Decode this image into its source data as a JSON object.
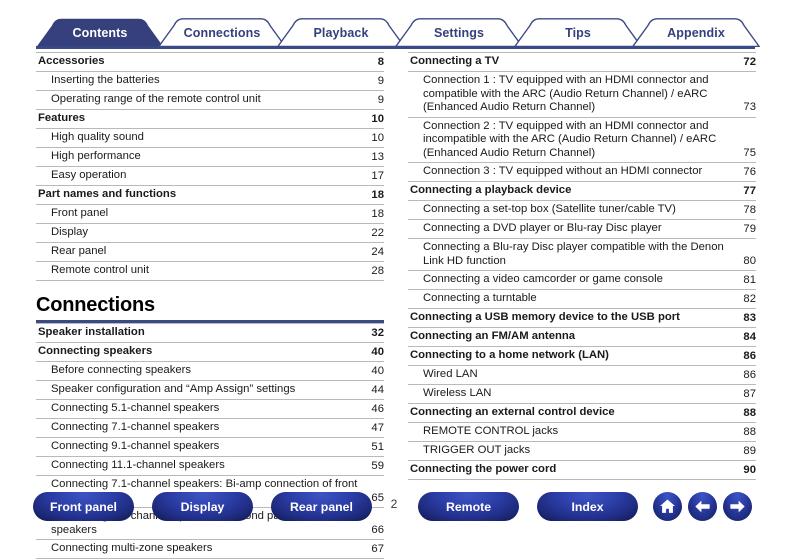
{
  "tabs": [
    {
      "label": "Contents",
      "active": true
    },
    {
      "label": "Connections",
      "active": false
    },
    {
      "label": "Playback",
      "active": false
    },
    {
      "label": "Settings",
      "active": false
    },
    {
      "label": "Tips",
      "active": false
    },
    {
      "label": "Appendix",
      "active": false
    }
  ],
  "left_column": {
    "groups": [
      {
        "type": "list",
        "rows": [
          {
            "level": 1,
            "title": "Accessories",
            "page": "8"
          },
          {
            "level": 2,
            "title": "Inserting the batteries",
            "page": "9"
          },
          {
            "level": 2,
            "title": "Operating range of the remote control unit",
            "page": "9"
          },
          {
            "level": 1,
            "title": "Features",
            "page": "10"
          },
          {
            "level": 2,
            "title": "High quality sound",
            "page": "10"
          },
          {
            "level": 2,
            "title": "High performance",
            "page": "13"
          },
          {
            "level": 2,
            "title": "Easy operation",
            "page": "17"
          },
          {
            "level": 1,
            "title": "Part names and functions",
            "page": "18"
          },
          {
            "level": 2,
            "title": "Front panel",
            "page": "18"
          },
          {
            "level": 2,
            "title": "Display",
            "page": "22"
          },
          {
            "level": 2,
            "title": "Rear panel",
            "page": "24"
          },
          {
            "level": 2,
            "title": "Remote control unit",
            "page": "28"
          }
        ]
      },
      {
        "type": "heading",
        "heading": "Connections"
      },
      {
        "type": "list",
        "rows": [
          {
            "level": 1,
            "title": "Speaker installation",
            "page": "32"
          },
          {
            "level": 1,
            "title": "Connecting speakers",
            "page": "40"
          },
          {
            "level": 2,
            "title": "Before connecting speakers",
            "page": "40"
          },
          {
            "level": 2,
            "title": "Speaker configuration and “Amp Assign” settings",
            "page": "44"
          },
          {
            "level": 2,
            "title": "Connecting 5.1-channel speakers",
            "page": "46"
          },
          {
            "level": 2,
            "title": "Connecting 7.1-channel speakers",
            "page": "47"
          },
          {
            "level": 2,
            "title": "Connecting 9.1-channel speakers",
            "page": "51"
          },
          {
            "level": 2,
            "title": "Connecting 11.1-channel speakers",
            "page": "59"
          },
          {
            "level": 2,
            "title": "Connecting 7.1-channel speakers: Bi-amp connection of front speakers",
            "page": "65"
          },
          {
            "level": 2,
            "title": "Connecting 7.1-channel speakers: Second pair of front speakers",
            "page": "66"
          },
          {
            "level": 2,
            "title": "Connecting multi-zone speakers",
            "page": "67"
          }
        ]
      }
    ]
  },
  "right_column": {
    "groups": [
      {
        "type": "list",
        "rows": [
          {
            "level": 1,
            "title": "Connecting a TV",
            "page": "72"
          },
          {
            "level": 2,
            "title": "Connection 1 : TV equipped with an HDMI connector and compatible with the ARC (Audio Return Channel) / eARC (Enhanced Audio Return Channel)",
            "page": "73"
          },
          {
            "level": 2,
            "title": "Connection 2 : TV equipped with an HDMI connector and incompatible with the ARC (Audio Return Channel) / eARC (Enhanced Audio Return Channel)",
            "page": "75"
          },
          {
            "level": 2,
            "title": "Connection 3 : TV equipped without an HDMI connector",
            "page": "76"
          },
          {
            "level": 1,
            "title": "Connecting a playback device",
            "page": "77"
          },
          {
            "level": 2,
            "title": "Connecting a set-top box (Satellite tuner/cable TV)",
            "page": "78"
          },
          {
            "level": 2,
            "title": "Connecting a DVD player or Blu-ray Disc player",
            "page": "79"
          },
          {
            "level": 2,
            "title": "Connecting a Blu-ray Disc player compatible with the Denon Link HD function",
            "page": "80"
          },
          {
            "level": 2,
            "title": "Connecting a video camcorder or game console",
            "page": "81"
          },
          {
            "level": 2,
            "title": "Connecting a turntable",
            "page": "82"
          },
          {
            "level": 1,
            "title": "Connecting a USB memory device to the USB port",
            "page": "83"
          },
          {
            "level": 1,
            "title": "Connecting an FM/AM antenna",
            "page": "84"
          },
          {
            "level": 1,
            "title": "Connecting to a home network (LAN)",
            "page": "86"
          },
          {
            "level": 2,
            "title": "Wired LAN",
            "page": "86"
          },
          {
            "level": 2,
            "title": "Wireless LAN",
            "page": "87"
          },
          {
            "level": 1,
            "title": "Connecting an external control device",
            "page": "88"
          },
          {
            "level": 2,
            "title": "REMOTE CONTROL jacks",
            "page": "88"
          },
          {
            "level": 2,
            "title": "TRIGGER OUT jacks",
            "page": "89"
          },
          {
            "level": 1,
            "title": "Connecting the power cord",
            "page": "90"
          }
        ]
      }
    ]
  },
  "footer": {
    "buttons": [
      {
        "label": "Front panel",
        "key": "front"
      },
      {
        "label": "Display",
        "key": "display"
      },
      {
        "label": "Rear panel",
        "key": "rear"
      },
      {
        "label": "Remote",
        "key": "remote"
      },
      {
        "label": "Index",
        "key": "index"
      }
    ],
    "page_number": "2",
    "icons": [
      {
        "name": "home-icon"
      },
      {
        "name": "arrow-left-icon"
      },
      {
        "name": "arrow-right-icon"
      }
    ]
  },
  "colors": {
    "navy": "#3b4a86",
    "tab_active_bg": "#35407c",
    "tab_text": "#35407c",
    "rule": "#b9b9b9",
    "button_blue": "#2b3ca5"
  }
}
